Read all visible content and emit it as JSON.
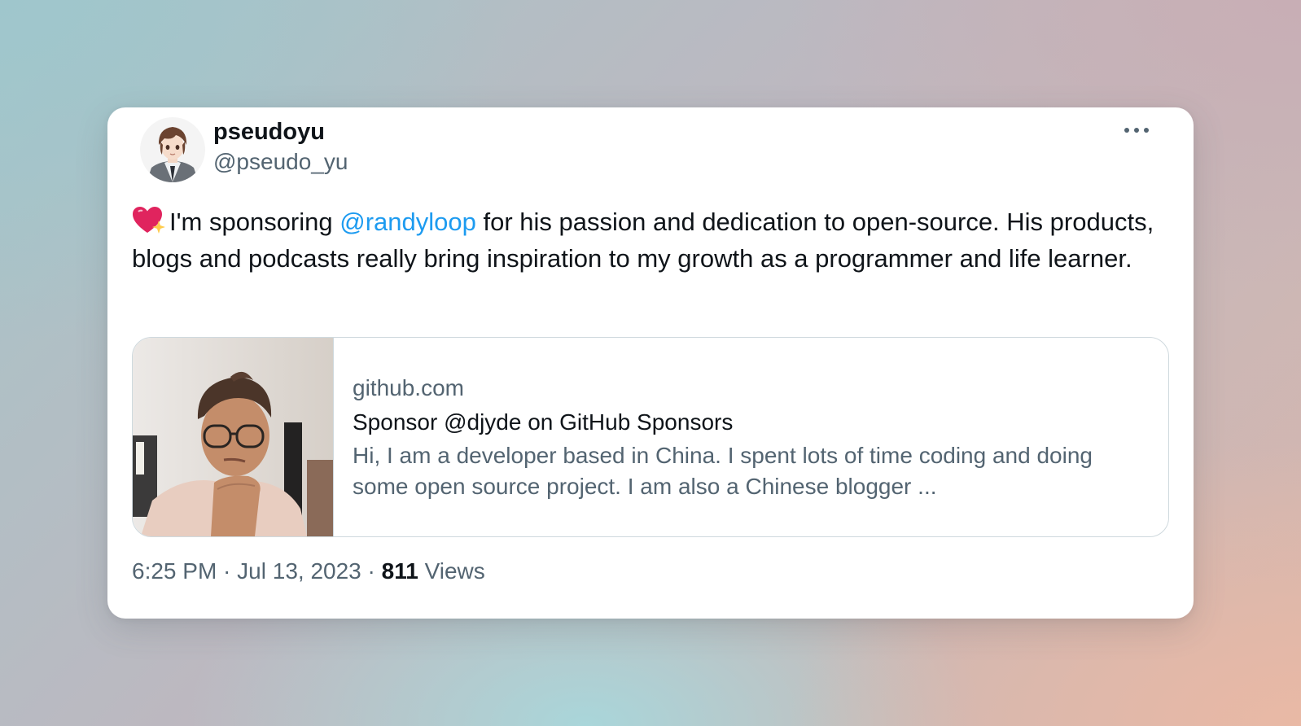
{
  "tweet": {
    "author": {
      "display_name": "pseudoyu",
      "handle": "@pseudo_yu",
      "avatar_icon": "anime-avatar-icon"
    },
    "more_icon": "more-horizontal-icon",
    "text": {
      "emoji": "sparkling-heart-icon",
      "before_mention": "I'm sponsoring ",
      "mention": "@randyloop",
      "after_mention": " for his passion and dedication to open-source. His products, blogs and podcasts really bring inspiration to my growth as a programmer and life learner."
    },
    "link_card": {
      "domain": "github.com",
      "title": "Sponsor @djyde on GitHub Sponsors",
      "description": "Hi, I am a developer based in China. I spent lots of time coding and doing some open source project. I am also a Chinese blogger ...",
      "thumbnail": "person-portrait-thumbnail"
    },
    "meta": {
      "time": "6:25 PM",
      "separator1": " · ",
      "date": "Jul 13, 2023",
      "separator2": " · ",
      "views_count": "811",
      "views_label": " Views"
    }
  },
  "colors": {
    "link": "#1d9bf0",
    "secondary_text": "#536471",
    "primary_text": "#0f1419",
    "border": "#cfd9de"
  }
}
